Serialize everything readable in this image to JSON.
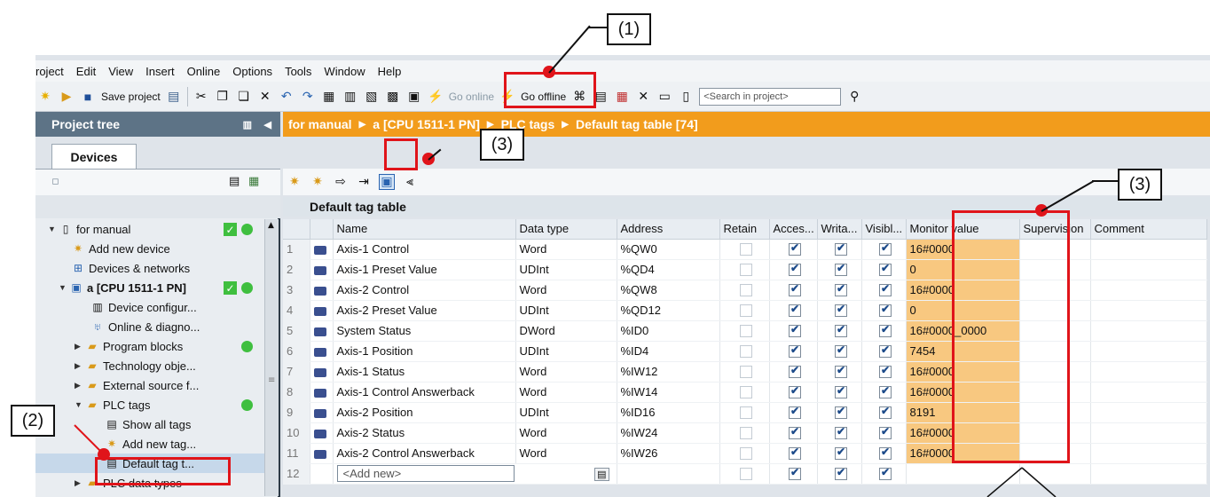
{
  "callouts": {
    "c1": "(1)",
    "c2": "(2)",
    "c3a": "(3)",
    "c3b": "(3)"
  },
  "menu": [
    "roject",
    "Edit",
    "View",
    "Insert",
    "Online",
    "Options",
    "Tools",
    "Window",
    "Help"
  ],
  "toolbar": {
    "save_project": "Save project",
    "go_online": "Go online",
    "go_offline": "Go offline",
    "search_placeholder": "<Search in project>"
  },
  "tree": {
    "header": "Project tree",
    "tab": "Devices",
    "items": [
      {
        "label": "for manual"
      },
      {
        "label": "Add new device"
      },
      {
        "label": "Devices & networks"
      },
      {
        "label": "a [CPU 1511-1 PN]"
      },
      {
        "label": "Device configur..."
      },
      {
        "label": "Online & diagno..."
      },
      {
        "label": "Program blocks"
      },
      {
        "label": "Technology obje..."
      },
      {
        "label": "External source f..."
      },
      {
        "label": "PLC tags"
      },
      {
        "label": "Show all tags"
      },
      {
        "label": "Add new tag..."
      },
      {
        "label": "Default tag t..."
      },
      {
        "label": "PLC data types"
      }
    ]
  },
  "breadcrumb": [
    "for manual",
    "a [CPU 1511-1 PN]",
    "PLC tags",
    "Default tag table [74]"
  ],
  "table": {
    "title": "Default tag table",
    "columns": [
      "",
      "",
      "Name",
      "Data type",
      "Address",
      "Retain",
      "Acces...",
      "Writa...",
      "Visibl...",
      "Monitor value",
      "Supervision",
      "Comment"
    ],
    "rows": [
      {
        "n": "1",
        "name": "Axis-1 Control",
        "type": "Word",
        "addr": "%QW0",
        "monitor": "16#0000"
      },
      {
        "n": "2",
        "name": "Axis-1 Preset Value",
        "type": "UDInt",
        "addr": "%QD4",
        "monitor": "0"
      },
      {
        "n": "3",
        "name": "Axis-2 Control",
        "type": "Word",
        "addr": "%QW8",
        "monitor": "16#0000"
      },
      {
        "n": "4",
        "name": "Axis-2 Preset Value",
        "type": "UDInt",
        "addr": "%QD12",
        "monitor": "0"
      },
      {
        "n": "5",
        "name": "System Status",
        "type": "DWord",
        "addr": "%ID0",
        "monitor": "16#0000_0000"
      },
      {
        "n": "6",
        "name": "Axis-1 Position",
        "type": "UDInt",
        "addr": "%ID4",
        "monitor": "7454"
      },
      {
        "n": "7",
        "name": "Axis-1 Status",
        "type": "Word",
        "addr": "%IW12",
        "monitor": "16#0000"
      },
      {
        "n": "8",
        "name": "Axis-1 Control Answerback",
        "type": "Word",
        "addr": "%IW14",
        "monitor": "16#0000"
      },
      {
        "n": "9",
        "name": "Axis-2 Position",
        "type": "UDInt",
        "addr": "%ID16",
        "monitor": "8191"
      },
      {
        "n": "10",
        "name": "Axis-2 Status",
        "type": "Word",
        "addr": "%IW24",
        "monitor": "16#0000"
      },
      {
        "n": "11",
        "name": "Axis-2 Control Answerback",
        "type": "Word",
        "addr": "%IW26",
        "monitor": "16#0000"
      }
    ],
    "add_new": {
      "n": "12",
      "placeholder": "<Add new>"
    }
  }
}
